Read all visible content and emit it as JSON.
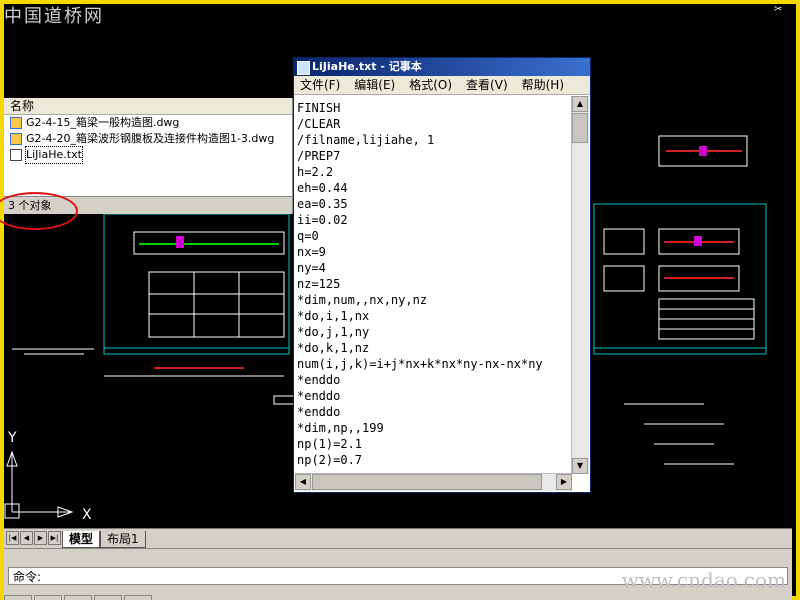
{
  "watermark_top": "中国道桥网",
  "watermark_bottom": "www.cndao.com",
  "explorer": {
    "column_header": "名称",
    "files": [
      {
        "name": "G2-4-15_箱梁一般构造图.dwg",
        "type": "dwg"
      },
      {
        "name": "G2-4-20_箱梁波形钢腹板及连接件构造图1-3.dwg",
        "type": "dwg"
      },
      {
        "name": "LiJiaHe.txt",
        "type": "txt"
      }
    ],
    "status": "3 个对象"
  },
  "notepad": {
    "title": "LiJiaHe.txt - 记事本",
    "menu": [
      "文件(F)",
      "编辑(E)",
      "格式(O)",
      "查看(V)",
      "帮助(H)"
    ],
    "lines": [
      "FINISH",
      "/CLEAR",
      "/filname,lijiahe, 1",
      "/PREP7",
      "h=2.2",
      "eh=0.44",
      "ea=0.35",
      "ii=0.02",
      "q=0",
      "nx=9",
      "ny=4",
      "nz=125",
      "*dim,num,,nx,ny,nz",
      "*do,i,1,nx",
      "*do,j,1,ny",
      "*do,k,1,nz",
      "num(i,j,k)=i+j*nx+k*nx*ny-nx-nx*ny",
      "*enddo",
      "*enddo",
      "*enddo",
      "*dim,np,,199",
      "np(1)=2.1",
      "np(2)=0.7"
    ]
  },
  "cad": {
    "tabs": [
      "模型",
      "布局1"
    ],
    "active_tab": "模型",
    "ucs_x": "X",
    "ucs_y": "Y",
    "command_prompt": "命令:"
  },
  "colors": {
    "frame": "#f5d800",
    "cad_background": "#000000",
    "drawing_frame": "#00c8c8",
    "highlight_ring": "#e01010",
    "title_bar": "#0a246a"
  }
}
